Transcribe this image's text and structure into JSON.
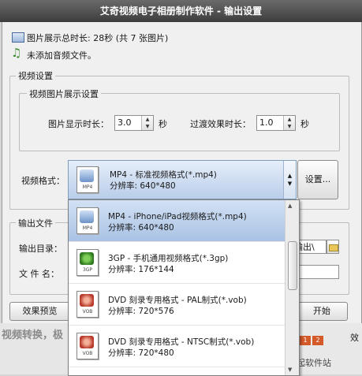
{
  "window": {
    "title": "艾奇视频电子相册制作软件 - 输出设置"
  },
  "info": {
    "total_duration": "图片展示总时长: 28秒 (共 7 张图片)",
    "audio_status": "未添加音频文件。"
  },
  "video_settings": {
    "group_label": "视频设置",
    "image_group_label": "视频图片展示设置",
    "image_display_label": "图片显示时长：",
    "image_display_value": "3.0",
    "image_display_unit": "秒",
    "transition_label": "过渡效果时长：",
    "transition_value": "1.0",
    "transition_unit": "秒",
    "format_label": "视频格式：",
    "selected_format_name": "MP4 - 标准视频格式(*.mp4)",
    "selected_format_res": "分辨率: 640*480",
    "settings_button": "设置..."
  },
  "output": {
    "group_label": "输出文件",
    "dir_label": "输出目录：",
    "dir_value_fragment": "输出\\",
    "file_label": "文 件 名："
  },
  "dropdown": {
    "items": [
      {
        "name": "MP4 - iPhone/iPad视频格式(*.mp4)",
        "res": "分辨率: 640*480",
        "badge": "MP4"
      },
      {
        "name": "3GP - 手机通用视频格式(*.3gp)",
        "res": "分辨率: 176*144",
        "badge": "3GP"
      },
      {
        "name": "DVD 刻录专用格式 - PAL制式(*.vob)",
        "res": "分辨率: 720*576",
        "badge": "VOB"
      },
      {
        "name": "DVD 刻录专用格式 - NTSC制式(*.vob)",
        "res": "分辨率: 720*480",
        "badge": "VOB"
      }
    ]
  },
  "buttons": {
    "preview": "效果预览",
    "start": "开始"
  },
  "background": {
    "page_1": "1",
    "page_2": "2",
    "side_text": "效",
    "bottom_text": "视频转换，极",
    "logo_text": "起软件站"
  },
  "colors": {
    "selection": "#b8cdea",
    "accent_green": "#3a7a2a",
    "accent_red": "#b83a2a"
  }
}
